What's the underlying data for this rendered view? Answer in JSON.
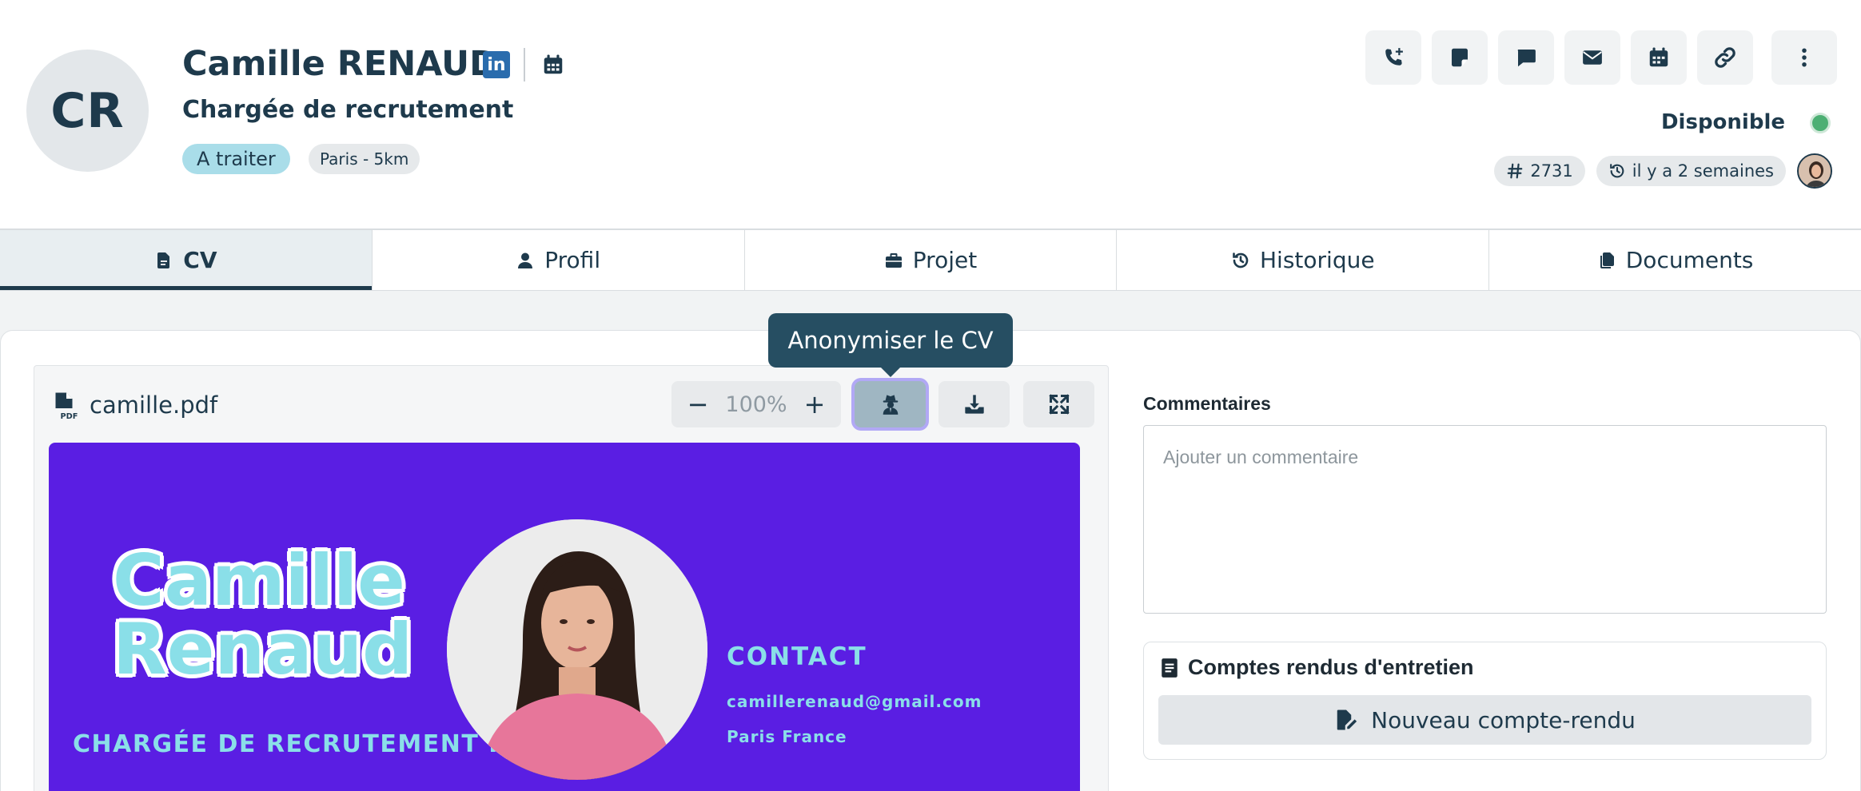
{
  "candidate": {
    "initials": "CR",
    "name": "Camille RENAUD",
    "linkedin_glyph": "in",
    "job_title": "Chargée de recrutement",
    "status_badge": "A traiter",
    "location_badge": "Paris - 5km",
    "availability": "Disponible",
    "availability_color": "#4caf73",
    "id_number": "2731",
    "last_update": "il y a 2 semaines"
  },
  "actions": [
    {
      "name": "call-button",
      "icon": "phone-plus-icon"
    },
    {
      "name": "note-button",
      "icon": "sticky-note-icon"
    },
    {
      "name": "message-button",
      "icon": "comment-icon"
    },
    {
      "name": "email-button",
      "icon": "envelope-icon"
    },
    {
      "name": "schedule-button",
      "icon": "calendar-icon"
    },
    {
      "name": "link-button",
      "icon": "link-icon"
    },
    {
      "name": "more-button",
      "icon": "ellipsis-vertical-icon"
    }
  ],
  "tabs": [
    {
      "label": "CV",
      "icon": "file-icon",
      "active": true
    },
    {
      "label": "Profil",
      "icon": "user-icon",
      "active": false
    },
    {
      "label": "Projet",
      "icon": "briefcase-icon",
      "active": false
    },
    {
      "label": "Historique",
      "icon": "history-icon",
      "active": false
    },
    {
      "label": "Documents",
      "icon": "documents-icon",
      "active": false
    }
  ],
  "viewer": {
    "file_name": "camille.pdf",
    "zoom_minus": "−",
    "zoom_level": "100%",
    "zoom_plus": "+",
    "tooltip": "Anonymiser le CV"
  },
  "cv": {
    "first_name": "Camille",
    "last_name": "Renaud",
    "role": "CHARGÉE DE RECRUTEMENT IT",
    "contact_heading": "CONTACT",
    "email": "camillerenaud@gmail.com",
    "city": "Paris France",
    "background_color": "#5a1ee3",
    "accent_color": "#8adfe8"
  },
  "comments": {
    "label": "Commentaires",
    "placeholder": "Ajouter un commentaire"
  },
  "reports": {
    "title": "Comptes rendus d'entretien",
    "new_button": "Nouveau compte-rendu"
  },
  "colors": {
    "primary": "#1e3a4c",
    "status_badge": "#a9dde9",
    "tooltip": "#264e62"
  }
}
